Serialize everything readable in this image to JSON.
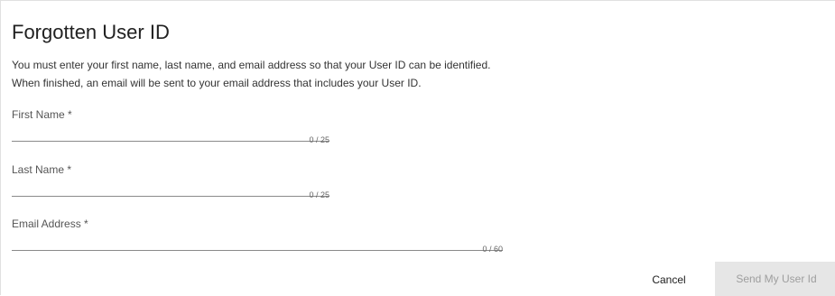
{
  "dialog": {
    "title": "Forgotten User ID",
    "description_line1": "You must enter your first name, last name, and email address so that your User ID can be identified.",
    "description_line2": "When finished, an email will be sent to your email address that includes your User ID."
  },
  "form": {
    "first_name": {
      "label": "First Name *",
      "value": "",
      "counter": "0 / 25",
      "max_length": 25
    },
    "last_name": {
      "label": "Last Name *",
      "value": "",
      "counter": "0 / 25",
      "max_length": 25
    },
    "email": {
      "label": "Email Address *",
      "value": "",
      "counter": "0 / 60",
      "max_length": 60
    }
  },
  "actions": {
    "cancel_label": "Cancel",
    "send_label": "Send My User Id",
    "send_enabled": false
  },
  "colors": {
    "disabled_button_bg": "#e6e6e6",
    "disabled_button_text": "#9e9e9e",
    "underline": "#8a8a8a"
  }
}
